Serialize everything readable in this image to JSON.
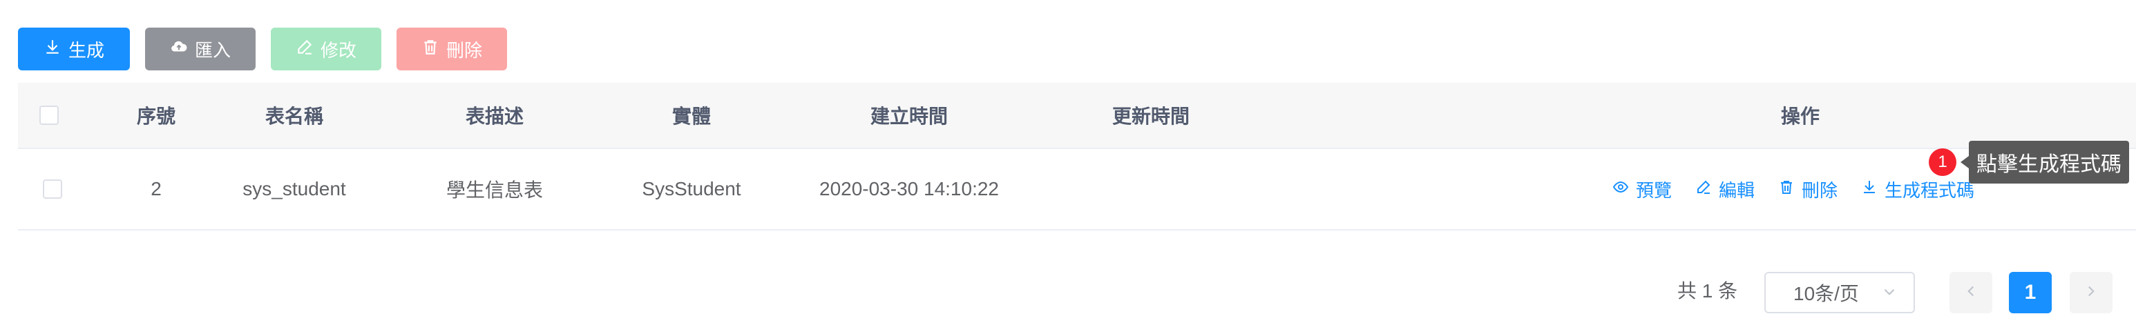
{
  "toolbar": {
    "generate_label": "生成",
    "import_label": "匯入",
    "edit_label": "修改",
    "delete_label": "刪除"
  },
  "table": {
    "columns": [
      "序號",
      "表名稱",
      "表描述",
      "實體",
      "建立時間",
      "更新時間",
      "操作"
    ],
    "rows": [
      {
        "index": "2",
        "table_name": "sys_student",
        "table_desc": "學生信息表",
        "entity": "SysStudent",
        "created": "2020-03-30 14:10:22",
        "updated": "",
        "actions": {
          "preview": "預覽",
          "edit": "編輯",
          "delete": "刪除",
          "generate": "生成程式碼"
        }
      }
    ]
  },
  "tooltip": {
    "badge": "1",
    "text": "點擊生成程式碼"
  },
  "pagination": {
    "total": "共 1 条",
    "page_size": "10条/页",
    "current_page": "1"
  },
  "colors": {
    "primary": "#1890ff",
    "import": "#909399",
    "edit_disabled": "#a5e7c0",
    "delete_disabled": "#fca5a5",
    "badge": "#f5222d",
    "tooltip_bg": "#595959"
  }
}
